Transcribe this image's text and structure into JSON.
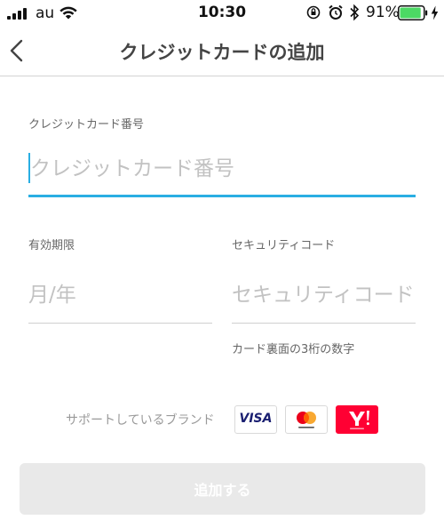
{
  "status_bar": {
    "carrier": "au",
    "time": "10:30",
    "battery_percent": "91%",
    "battery_level": 0.91,
    "icons": [
      "signal-icon",
      "wifi-icon",
      "rotation-lock-icon",
      "alarm-icon",
      "bluetooth-icon",
      "battery-icon",
      "charging-icon"
    ]
  },
  "nav": {
    "title": "クレジットカードの追加",
    "back_icon": "chevron-left-icon"
  },
  "form": {
    "card_number": {
      "label": "クレジットカード番号",
      "placeholder": "クレジットカード番号",
      "value": ""
    },
    "expiry": {
      "label": "有効期限",
      "placeholder": "月/年",
      "value": ""
    },
    "security_code": {
      "label": "セキュリティコード",
      "placeholder": "セキュリティコード",
      "value": "",
      "hint": "カード裏面の3桁の数字"
    }
  },
  "brands": {
    "label": "サポートしているブランド",
    "items": [
      {
        "name": "visa-logo",
        "text": "VISA"
      },
      {
        "name": "mastercard-logo"
      },
      {
        "name": "yahoo-logo"
      }
    ]
  },
  "submit": {
    "label": "追加する"
  },
  "colors": {
    "accent": "#2aaee3",
    "title_text": "#444444",
    "disabled_button": "#e9e9e9",
    "battery_green": "#4cd964"
  }
}
